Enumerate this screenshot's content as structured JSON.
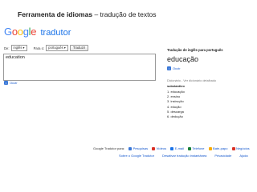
{
  "header": {
    "title": "Ferramenta de idiomas",
    "subtitle": "– tradução de textos"
  },
  "logo": {
    "google": "Google",
    "product": "tradutor"
  },
  "toolbar": {
    "from_label": "De:",
    "from_value": "inglês",
    "to_label": "Para o:",
    "to_value": "português",
    "translate_button": "Traduzir"
  },
  "input": {
    "text": "education",
    "listen": "Ouvir"
  },
  "result": {
    "heading": "Tradução de inglês para português",
    "word": "educação",
    "listen": "Ouvir",
    "dictionary_note": "Dicionário - Ver dicionário detalhado",
    "part_of_speech": "substantivo",
    "items": [
      "1. educação",
      "2. ensino",
      "3. instrução",
      "4. edução",
      "5. descarga",
      "6. dedução"
    ]
  },
  "footer": {
    "tools_label": "Google Tradutor para:",
    "links": [
      {
        "label": "Pesquisas",
        "icon": "magnifier-icon",
        "color": "#3a78d8"
      },
      {
        "label": "Vídeos",
        "icon": "video-icon",
        "color": "#d93025"
      },
      {
        "label": "E-mail",
        "icon": "mail-icon",
        "color": "#1a73e8"
      },
      {
        "label": "Telefone",
        "icon": "phone-icon",
        "color": "#188038"
      },
      {
        "label": "Bate-papo",
        "icon": "chat-icon",
        "color": "#f9ab00"
      },
      {
        "label": "Negócios",
        "icon": "business-icon",
        "color": "#d93025"
      }
    ],
    "bottom_links": [
      "Sobre o Google Tradutor",
      "Desativar tradução instantânea",
      "Privacidade",
      "Ajuda"
    ]
  }
}
